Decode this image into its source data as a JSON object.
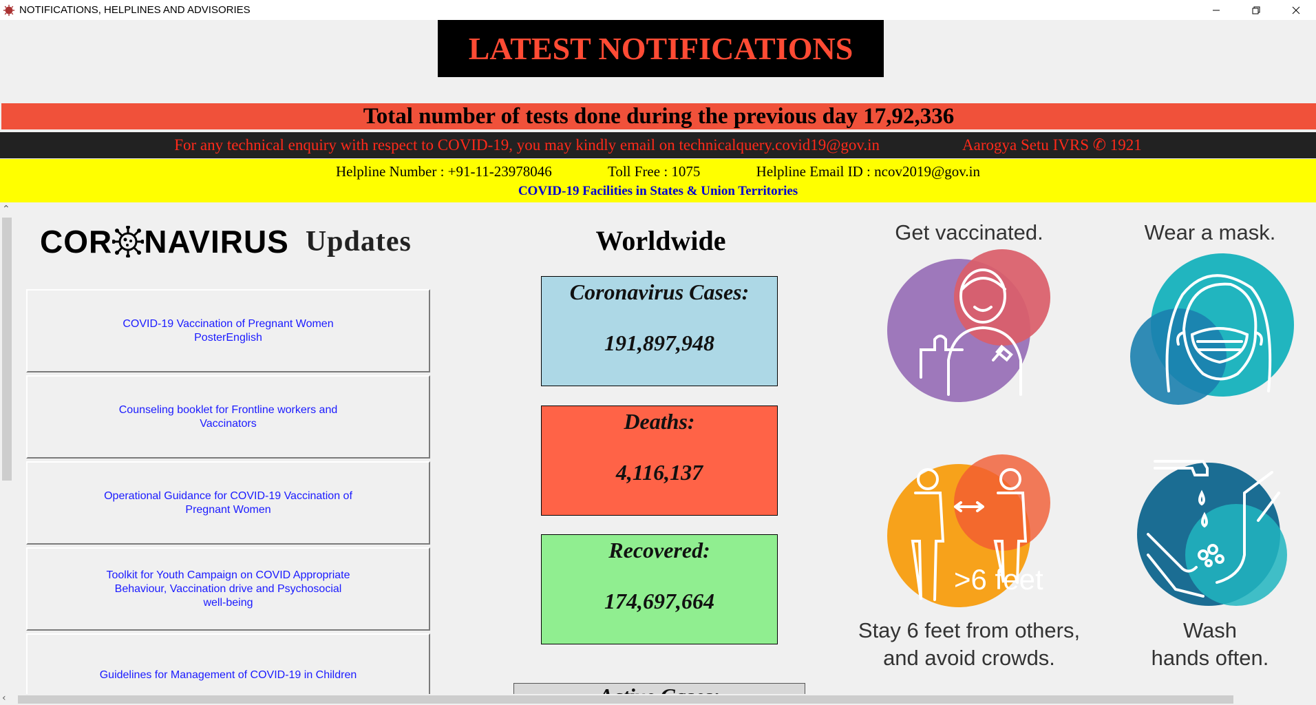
{
  "window": {
    "title": "NOTIFICATIONS, HELPLINES AND ADVISORIES",
    "controls": [
      "minimize",
      "restore",
      "close"
    ]
  },
  "banner": {
    "text": "LATEST NOTIFICATIONS"
  },
  "tests_bar": {
    "text": "Total number of tests done during the previous day 17,92,336"
  },
  "enquiry_bar": {
    "text": "For any technical enquiry with respect to COVID-19, you may kindly email on technicalquery.covid19@gov.in",
    "ivrs": "Aarogya Setu IVRS ✆ 1921"
  },
  "helpline": {
    "number": "Helpline Number : +91-11-23978046",
    "toll_free": "Toll Free : 1075",
    "email": "Helpline Email ID : ncov2019@gov.in",
    "facilities_link": "COVID-19 Facilities in States & Union Territories"
  },
  "logo": {
    "left": "COR",
    "right": "NAVIRUS",
    "updates": "Updates"
  },
  "documents": [
    "COVID-19 Vaccination of Pregnant Women\nPosterEnglish",
    "Counseling booklet for Frontline workers and\nVaccinators",
    "Operational Guidance for COVID-19 Vaccination of\nPregnant Women",
    "Toolkit for Youth Campaign on COVID Appropriate\nBehaviour, Vaccination drive and Psychosocial\nwell-being",
    "Guidelines for Management of COVID-19 in Children"
  ],
  "worldwide": {
    "heading": "Worldwide",
    "cases": {
      "label": "Coronavirus Cases:",
      "value": "191,897,948",
      "color": "#add8e6"
    },
    "deaths": {
      "label": "Deaths:",
      "value": "4,116,137",
      "color": "#ff6347"
    },
    "recovered": {
      "label": "Recovered:",
      "value": "174,697,664",
      "color": "#90ee90"
    },
    "active": {
      "label": "Active Cases:"
    }
  },
  "tips": {
    "vaccinated": "Get vaccinated.",
    "mask": "Wear a mask.",
    "distance": "Stay 6 feet from others,\nand avoid crowds.",
    "distance_sign": ">6 feet",
    "wash": "Wash\nhands often."
  },
  "colors": {
    "banner_text": "#ff4b34",
    "tests_bar": "#f0513a",
    "enquiry_text": "#ff2a1a",
    "helpline_bar": "#ffff00",
    "link": "#1a1aff"
  }
}
